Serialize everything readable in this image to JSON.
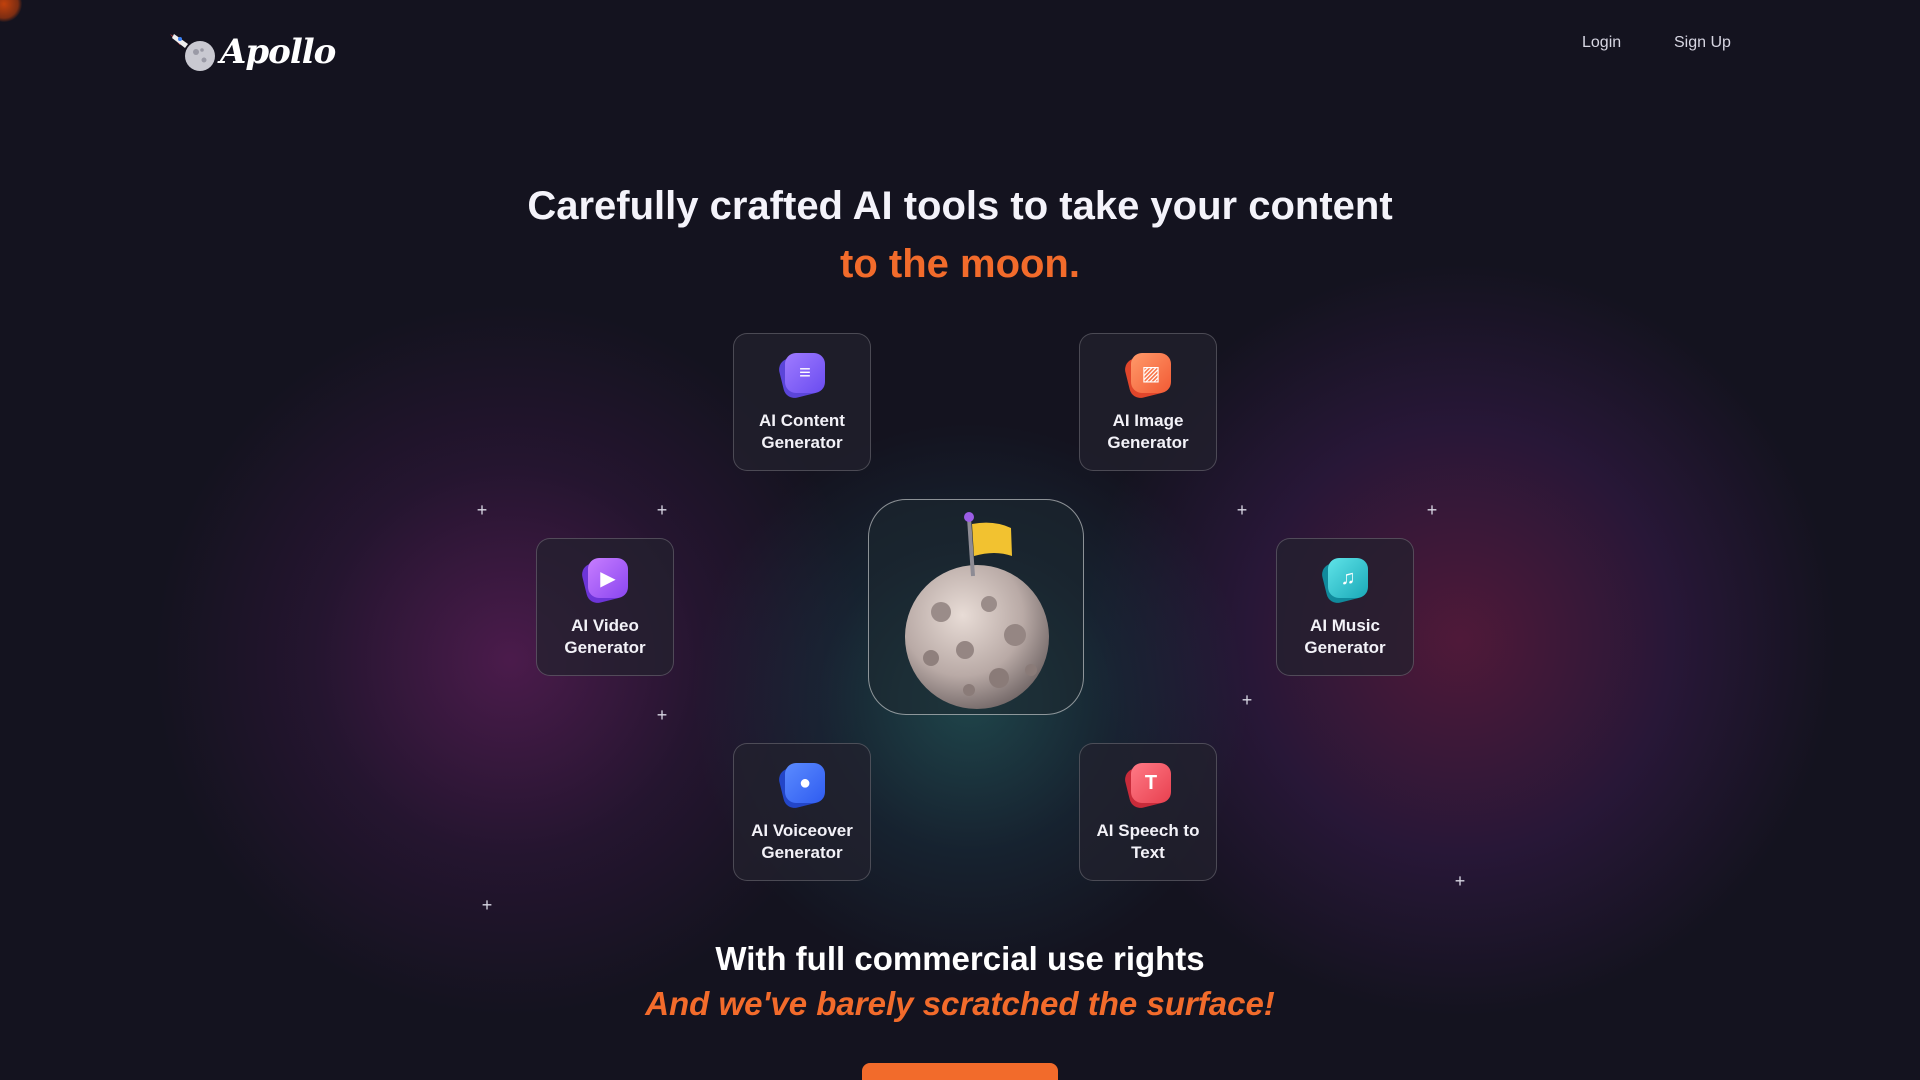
{
  "brand": {
    "name": "Apollo"
  },
  "nav": {
    "login": "Login",
    "signup": "Sign Up"
  },
  "hero": {
    "headline": "Carefully crafted AI tools to take your content",
    "headline_accent": "to the moon."
  },
  "tools": [
    {
      "label": "AI Content Generator",
      "icon": "content-icon"
    },
    {
      "label": "AI Image Generator",
      "icon": "image-icon"
    },
    {
      "label": "AI Video Generator",
      "icon": "video-icon"
    },
    {
      "label": "AI Music Generator",
      "icon": "music-icon"
    },
    {
      "label": "AI Voiceover Generator",
      "icon": "voiceover-icon"
    },
    {
      "label": "AI Speech to Text",
      "icon": "speech-to-text-icon"
    }
  ],
  "footer_text": {
    "rights": "With full commercial use rights",
    "tagline": "And we've barely scratched the surface!"
  },
  "colors": {
    "accent": "#f26b2b",
    "background": "#14131f"
  }
}
